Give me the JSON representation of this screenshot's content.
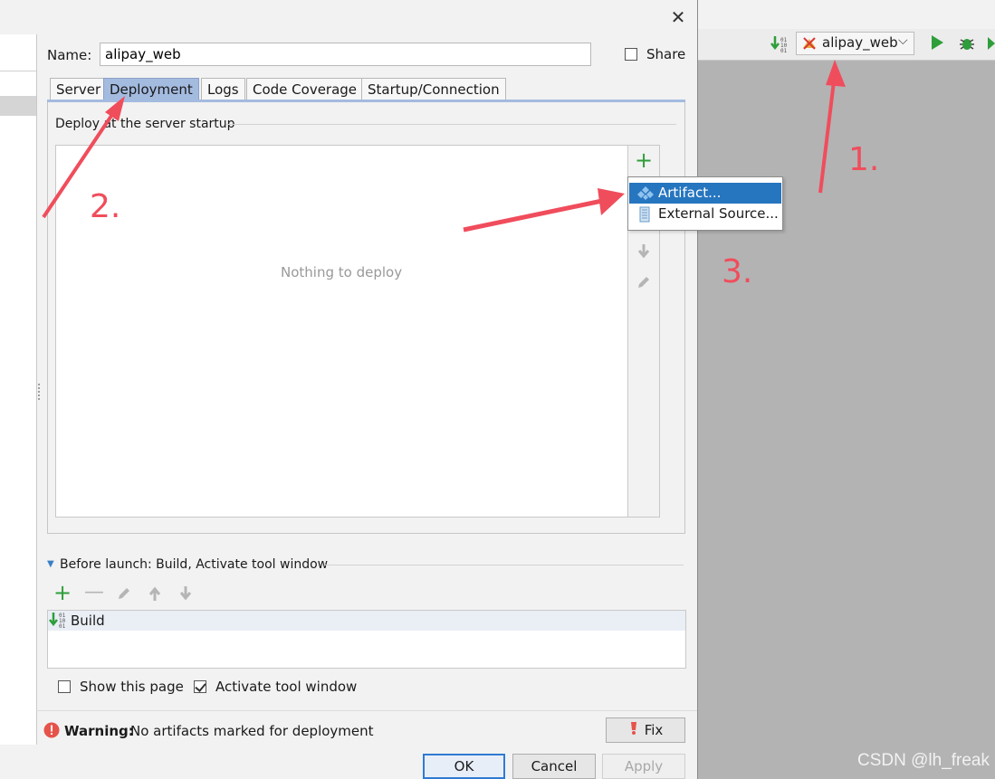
{
  "dialog": {
    "name_label": "Name:",
    "name_value": "alipay_web",
    "share_label": "Share",
    "tabs": [
      {
        "label": "Server"
      },
      {
        "label": "Deployment"
      },
      {
        "label": "Logs"
      },
      {
        "label": "Code Coverage"
      },
      {
        "label": "Startup/Connection"
      }
    ],
    "deploy_heading": "Deploy at the server startup",
    "empty_text": "Nothing to deploy",
    "popup_items": [
      {
        "label": "Artifact...",
        "icon": "artifact-icon"
      },
      {
        "label": "External Source...",
        "icon": "external-source-icon"
      }
    ],
    "before_launch": "Before launch: Build, Activate tool window",
    "build_item": "Build",
    "show_page_label": "Show this page",
    "show_page_checked": false,
    "activate_tool_label": "Activate tool window",
    "activate_tool_checked": true,
    "warning_bold": "Warning:",
    "warning_text": "No artifacts marked for deployment",
    "fix_label": "Fix",
    "ok_label": "OK",
    "cancel_label": "Cancel",
    "apply_label": "Apply"
  },
  "toolbar": {
    "run_config": "alipay_web"
  },
  "annotations": {
    "n1": "1.",
    "n2": "2.",
    "n3": "3.",
    "color": "#f04d5c"
  },
  "watermark": "CSDN @lh_freak"
}
